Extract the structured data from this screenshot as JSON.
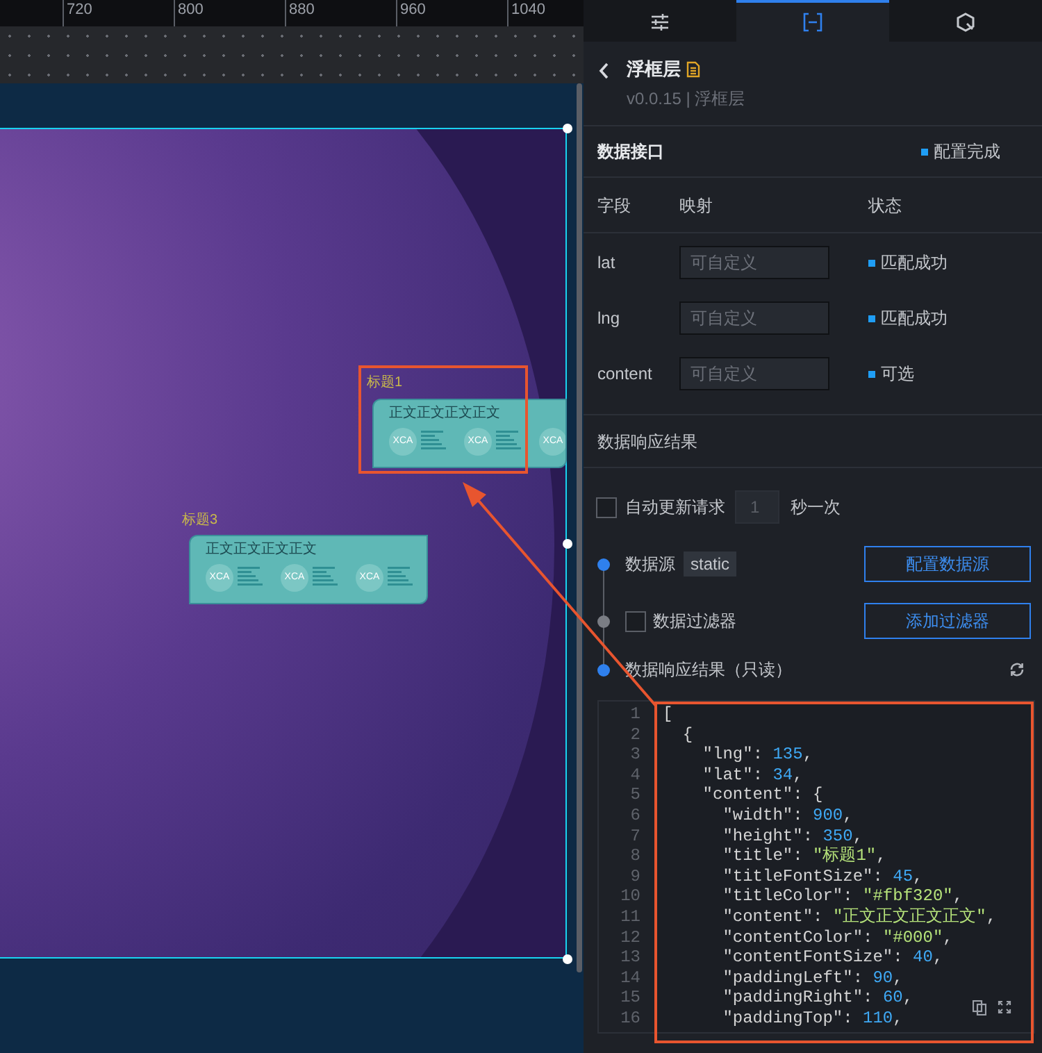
{
  "ruler": {
    "ticks": [
      "720",
      "800",
      "880",
      "960",
      "1040"
    ]
  },
  "canvas": {
    "popups": [
      {
        "title": "标题1",
        "content": "正文正文正文正文",
        "items": [
          "XCA",
          "XCA",
          "XCA"
        ],
        "highlighted": true
      },
      {
        "title": "标题3",
        "content": "正文正文正文正文",
        "items": [
          "XCA",
          "XCA",
          "XCA"
        ],
        "highlighted": false
      }
    ]
  },
  "panel": {
    "tabs": [
      {
        "kind": "sliders",
        "selected": false
      },
      {
        "kind": "brackets",
        "selected": true
      },
      {
        "kind": "hexagon",
        "selected": false
      }
    ],
    "header": {
      "title": "浮框层",
      "subtitle": "v0.0.15 | 浮框层"
    },
    "data_interface": {
      "title": "数据接口",
      "status": "配置完成"
    },
    "fields": {
      "columns": [
        "字段",
        "映射",
        "状态"
      ],
      "rows": [
        {
          "name": "lat",
          "placeholder": "可自定义",
          "status": "匹配成功"
        },
        {
          "name": "lng",
          "placeholder": "可自定义",
          "status": "匹配成功"
        },
        {
          "name": "content",
          "placeholder": "可自定义",
          "status": "可选"
        }
      ]
    },
    "response": {
      "title": "数据响应结果",
      "auto_update": {
        "label": "自动更新请求",
        "checked": false,
        "value": "1",
        "unit": "秒一次"
      },
      "steps": [
        {
          "kind": "source",
          "label": "数据源",
          "tag": "static",
          "button": "配置数据源",
          "active": true
        },
        {
          "kind": "filter",
          "label": "数据过滤器",
          "checked": false,
          "button": "添加过滤器",
          "active": false
        },
        {
          "kind": "result",
          "label": "数据响应结果（只读）",
          "active": true
        }
      ],
      "code": {
        "highlighted": true,
        "lines": [
          {
            "number": "1",
            "tokens": [
              {
                "kind": "punct",
                "text": "["
              }
            ]
          },
          {
            "number": "2",
            "tokens": [
              {
                "kind": "punct",
                "text": "  {"
              }
            ]
          },
          {
            "number": "3",
            "tokens": [
              {
                "kind": "key",
                "text": "    \"lng\""
              },
              {
                "kind": "punct",
                "text": ": "
              },
              {
                "kind": "number",
                "text": "135"
              },
              {
                "kind": "punct",
                "text": ","
              }
            ]
          },
          {
            "number": "4",
            "tokens": [
              {
                "kind": "key",
                "text": "    \"lat\""
              },
              {
                "kind": "punct",
                "text": ": "
              },
              {
                "kind": "number",
                "text": "34"
              },
              {
                "kind": "punct",
                "text": ","
              }
            ]
          },
          {
            "number": "5",
            "tokens": [
              {
                "kind": "key",
                "text": "    \"content\""
              },
              {
                "kind": "punct",
                "text": ": {"
              }
            ]
          },
          {
            "number": "6",
            "tokens": [
              {
                "kind": "key",
                "text": "      \"width\""
              },
              {
                "kind": "punct",
                "text": ": "
              },
              {
                "kind": "number",
                "text": "900"
              },
              {
                "kind": "punct",
                "text": ","
              }
            ]
          },
          {
            "number": "7",
            "tokens": [
              {
                "kind": "key",
                "text": "      \"height\""
              },
              {
                "kind": "punct",
                "text": ": "
              },
              {
                "kind": "number",
                "text": "350"
              },
              {
                "kind": "punct",
                "text": ","
              }
            ]
          },
          {
            "number": "8",
            "tokens": [
              {
                "kind": "key",
                "text": "      \"title\""
              },
              {
                "kind": "punct",
                "text": ": "
              },
              {
                "kind": "string",
                "text": "\"标题1\""
              },
              {
                "kind": "punct",
                "text": ","
              }
            ]
          },
          {
            "number": "9",
            "tokens": [
              {
                "kind": "key",
                "text": "      \"titleFontSize\""
              },
              {
                "kind": "punct",
                "text": ": "
              },
              {
                "kind": "number",
                "text": "45"
              },
              {
                "kind": "punct",
                "text": ","
              }
            ]
          },
          {
            "number": "10",
            "tokens": [
              {
                "kind": "key",
                "text": "      \"titleColor\""
              },
              {
                "kind": "punct",
                "text": ": "
              },
              {
                "kind": "string",
                "text": "\"#fbf320\""
              },
              {
                "kind": "punct",
                "text": ","
              }
            ]
          },
          {
            "number": "11",
            "tokens": [
              {
                "kind": "key",
                "text": "      \"content\""
              },
              {
                "kind": "punct",
                "text": ": "
              },
              {
                "kind": "string",
                "text": "\"正文正文正文正文\""
              },
              {
                "kind": "punct",
                "text": ","
              }
            ]
          },
          {
            "number": "12",
            "tokens": [
              {
                "kind": "key",
                "text": "      \"contentColor\""
              },
              {
                "kind": "punct",
                "text": ": "
              },
              {
                "kind": "string",
                "text": "\"#000\""
              },
              {
                "kind": "punct",
                "text": ","
              }
            ]
          },
          {
            "number": "13",
            "tokens": [
              {
                "kind": "key",
                "text": "      \"contentFontSize\""
              },
              {
                "kind": "punct",
                "text": ": "
              },
              {
                "kind": "number",
                "text": "40"
              },
              {
                "kind": "punct",
                "text": ","
              }
            ]
          },
          {
            "number": "14",
            "tokens": [
              {
                "kind": "key",
                "text": "      \"paddingLeft\""
              },
              {
                "kind": "punct",
                "text": ": "
              },
              {
                "kind": "number",
                "text": "90"
              },
              {
                "kind": "punct",
                "text": ","
              }
            ]
          },
          {
            "number": "15",
            "tokens": [
              {
                "kind": "key",
                "text": "      \"paddingRight\""
              },
              {
                "kind": "punct",
                "text": ": "
              },
              {
                "kind": "number",
                "text": "60"
              },
              {
                "kind": "punct",
                "text": ","
              }
            ]
          },
          {
            "number": "16",
            "tokens": [
              {
                "kind": "key",
                "text": "      \"paddingTop\""
              },
              {
                "kind": "punct",
                "text": ": "
              },
              {
                "kind": "number",
                "text": "110"
              },
              {
                "kind": "punct",
                "text": ","
              }
            ]
          }
        ]
      }
    }
  }
}
